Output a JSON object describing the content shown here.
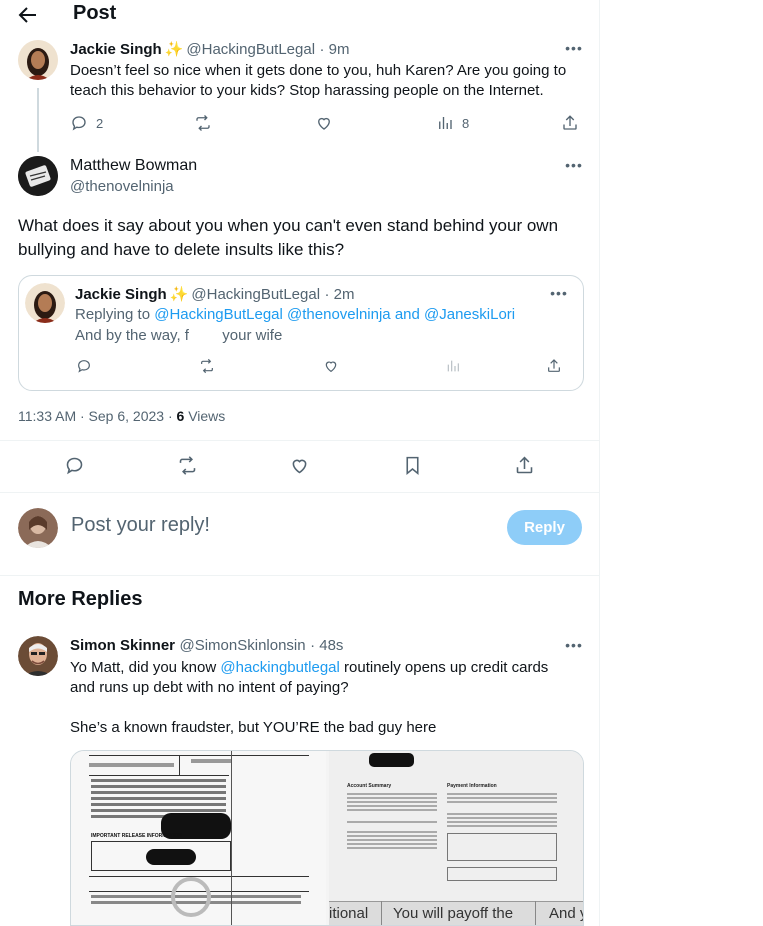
{
  "header": {
    "title": "Post"
  },
  "parent_tweet": {
    "name": "Jackie Singh",
    "badge": "✨",
    "handle": "@HackingButLegal",
    "time": "· 9m",
    "text": "Doesn’t feel so nice when it gets done to you, huh Karen? Are you going to teach this behavior to your kids? Stop harassing people on the Internet.",
    "replies": "2",
    "views": "8"
  },
  "main_tweet": {
    "name": "Matthew Bowman",
    "handle": "@thenovelninja",
    "text": "What does it say about you when you can't even stand behind your own bullying and have to delete insults like this?",
    "timestamp": "11:33 AM · Sep 6, 2023 · ",
    "views_count": "6",
    "views_label": " Views"
  },
  "quoted_tweet": {
    "name": "Jackie Singh",
    "badge": "✨",
    "handle": "@HackingButLegal",
    "time": "· 2m",
    "replying_prefix": "Replying to ",
    "replying_to": "@HackingButLegal @thenovelninja and @JaneskiLori",
    "text": "And by the way, f        your wife"
  },
  "composer": {
    "placeholder": "Post your reply!",
    "button": "Reply"
  },
  "more_replies": {
    "title": "More Replies",
    "reply": {
      "name": "Simon Skinner",
      "handle": "@SimonSkinlonsin",
      "time": "· 48s",
      "text_line1_prefix": "Yo Matt, did you know ",
      "text_mention": "@hackingbutlegal",
      "text_line1_suffix": " routinely opens up credit cards",
      "text_line2": "and runs up debt with no intent of paying?",
      "text_line3": "She’s a known fraudster, but YOU’RE the bad guy here",
      "image_left_heading": "IMPORTANT RELEASE INFORMATION",
      "image_right_heading1": "Account Summary",
      "image_right_heading2": "Payment Information",
      "image_caption1": "itional",
      "image_caption2": "You will payoff the",
      "image_caption3": "And y"
    }
  },
  "colors": {
    "accent": "#1d9bf0",
    "reply_button": "#8ecdf8",
    "muted_text": "#536471",
    "border": "#cfd9de"
  }
}
